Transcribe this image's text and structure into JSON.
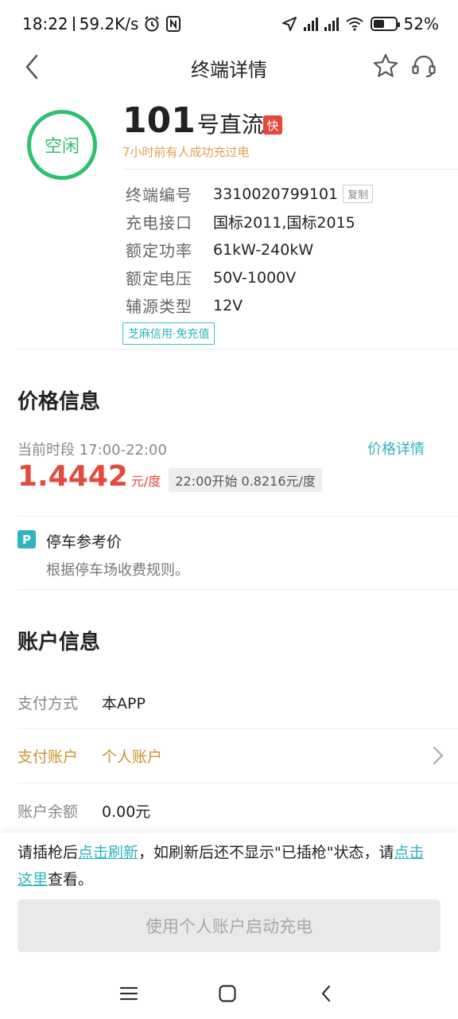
{
  "status_bar": {
    "time": "18:22",
    "net_speed": "59.2K/s",
    "battery": "52%",
    "battery_level": 0.52,
    "icons": [
      "alarm-icon",
      "nfc-icon",
      "location-icon",
      "hd-signal-icon",
      "wifi-icon",
      "battery-icon"
    ]
  },
  "nav": {
    "title": "终端详情",
    "icons": [
      "back-arrow-icon",
      "star-icon",
      "headset-icon"
    ]
  },
  "terminal": {
    "status": "空闲",
    "number": "101",
    "name_suffix": "号直流",
    "fast_badge": "快",
    "subtitle": "7小时前有人成功充过电",
    "specs": [
      {
        "label": "终端编号",
        "value": "3310020799101"
      },
      {
        "label": "充电接口",
        "value": "国标2011,国标2015"
      },
      {
        "label": "额定功率",
        "value": "61kW-240kW"
      },
      {
        "label": "额定电压",
        "value": "50V-1000V"
      },
      {
        "label": "辅源类型",
        "value": "12V"
      }
    ],
    "copy_label": "复制",
    "credit_tag": "芝麻信用·免充值"
  },
  "price": {
    "section_title": "价格信息",
    "current_period": "当前时段 17:00-22:00",
    "detail_link": "价格详情",
    "current_price": "1.4442",
    "unit": "元/度",
    "next_price": "22:00开始  0.8216元/度"
  },
  "parking": {
    "icon_letter": "P",
    "title": "停车参考价",
    "desc": "根据停车场收费规则。"
  },
  "account": {
    "section_title": "账户信息",
    "rows": [
      {
        "label": "支付方式",
        "value": "本APP"
      },
      {
        "label": "支付账户",
        "value": "个人账户"
      },
      {
        "label": "账户余额",
        "value": "0.00元"
      }
    ]
  },
  "notice": {
    "part1": "请插枪后",
    "link1": "点击刷新",
    "part2": "，如刷新后还不显示\"已插枪\"状态，请",
    "link2": "点击这里",
    "part3": "查看。"
  },
  "start_button": "使用个人账户启动充电",
  "colors": {
    "accent": "#2fb4bf",
    "status_green": "#2fbf71",
    "price_red": "#e24a3b",
    "gold": "#c8942c",
    "badge_red": "#e8453c"
  }
}
